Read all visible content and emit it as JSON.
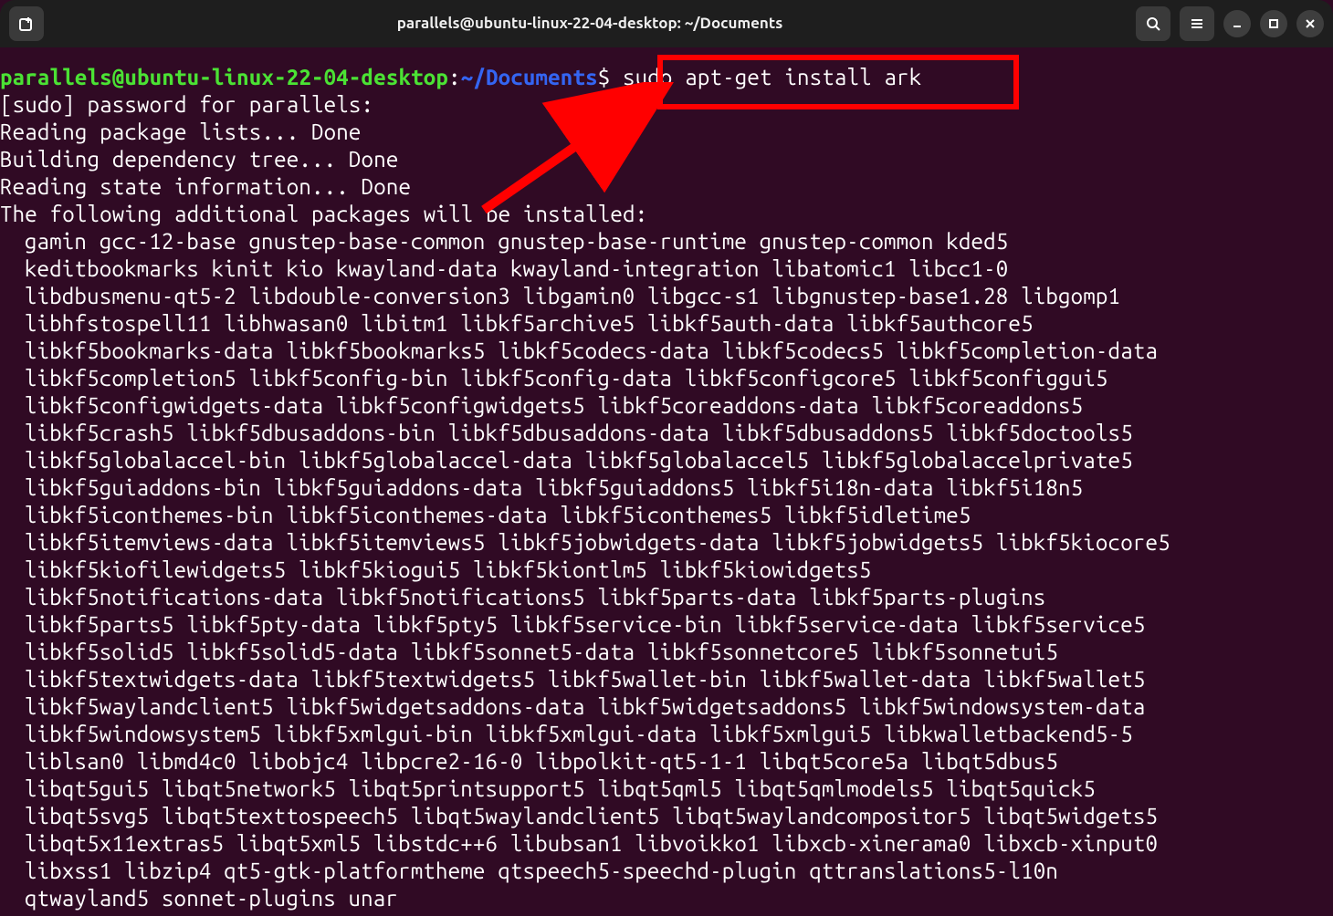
{
  "window": {
    "title": "parallels@ubuntu-linux-22-04-desktop: ~/Documents"
  },
  "prompt": {
    "user": "parallels@ubuntu-linux-22-04-desktop",
    "sep1": ":",
    "path": "~/Documents",
    "sep2": "$",
    "command": " sudo apt-get install ark"
  },
  "output": {
    "lines": [
      "[sudo] password for parallels: ",
      "Reading package lists... Done",
      "Building dependency tree... Done",
      "Reading state information... Done",
      "The following additional packages will be installed:"
    ],
    "pkg_lines": [
      "gamin gcc-12-base gnustep-base-common gnustep-base-runtime gnustep-common kded5",
      "keditbookmarks kinit kio kwayland-data kwayland-integration libatomic1 libcc1-0",
      "libdbusmenu-qt5-2 libdouble-conversion3 libgamin0 libgcc-s1 libgnustep-base1.28 libgomp1",
      "libhfstospell11 libhwasan0 libitm1 libkf5archive5 libkf5auth-data libkf5authcore5",
      "libkf5bookmarks-data libkf5bookmarks5 libkf5codecs-data libkf5codecs5 libkf5completion-data",
      "libkf5completion5 libkf5config-bin libkf5config-data libkf5configcore5 libkf5configgui5",
      "libkf5configwidgets-data libkf5configwidgets5 libkf5coreaddons-data libkf5coreaddons5",
      "libkf5crash5 libkf5dbusaddons-bin libkf5dbusaddons-data libkf5dbusaddons5 libkf5doctools5",
      "libkf5globalaccel-bin libkf5globalaccel-data libkf5globalaccel5 libkf5globalaccelprivate5",
      "libkf5guiaddons-bin libkf5guiaddons-data libkf5guiaddons5 libkf5i18n-data libkf5i18n5",
      "libkf5iconthemes-bin libkf5iconthemes-data libkf5iconthemes5 libkf5idletime5",
      "libkf5itemviews-data libkf5itemviews5 libkf5jobwidgets-data libkf5jobwidgets5 libkf5kiocore5",
      "libkf5kiofilewidgets5 libkf5kiogui5 libkf5kiontlm5 libkf5kiowidgets5",
      "libkf5notifications-data libkf5notifications5 libkf5parts-data libkf5parts-plugins",
      "libkf5parts5 libkf5pty-data libkf5pty5 libkf5service-bin libkf5service-data libkf5service5",
      "libkf5solid5 libkf5solid5-data libkf5sonnet5-data libkf5sonnetcore5 libkf5sonnetui5",
      "libkf5textwidgets-data libkf5textwidgets5 libkf5wallet-bin libkf5wallet-data libkf5wallet5",
      "libkf5waylandclient5 libkf5widgetsaddons-data libkf5widgetsaddons5 libkf5windowsystem-data",
      "libkf5windowsystem5 libkf5xmlgui-bin libkf5xmlgui-data libkf5xmlgui5 libkwalletbackend5-5",
      "liblsan0 libmd4c0 libobjc4 libpcre2-16-0 libpolkit-qt5-1-1 libqt5core5a libqt5dbus5",
      "libqt5gui5 libqt5network5 libqt5printsupport5 libqt5qml5 libqt5qmlmodels5 libqt5quick5",
      "libqt5svg5 libqt5texttospeech5 libqt5waylandclient5 libqt5waylandcompositor5 libqt5widgets5",
      "libqt5x11extras5 libqt5xml5 libstdc++6 libubsan1 libvoikko1 libxcb-xinerama0 libxcb-xinput0",
      "libxss1 libzip4 qt5-gtk-platformtheme qtspeech5-speechd-plugin qttranslations5-l10n",
      "qtwayland5 sonnet-plugins unar"
    ]
  }
}
